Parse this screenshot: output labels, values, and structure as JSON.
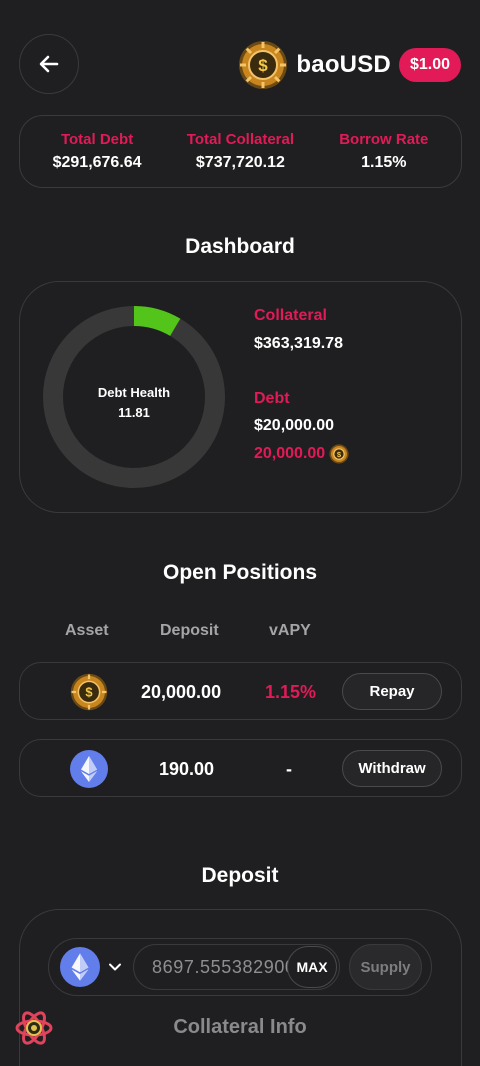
{
  "header": {
    "brand_name": "baoUSD",
    "price": "$1.00",
    "brand_icon": "baousd-coin-icon",
    "back_icon": "arrow-left-icon"
  },
  "stats": [
    {
      "label": "Total Debt",
      "value": "$291,676.64"
    },
    {
      "label": "Total Collateral",
      "value": "$737,720.12"
    },
    {
      "label": "Borrow Rate",
      "value": "1.15%"
    }
  ],
  "dashboard": {
    "title": "Dashboard",
    "health_label": "Debt Health",
    "health_value": "11.81",
    "health_gauge_fraction": 0.085,
    "collateral_label": "Collateral",
    "collateral_value": "$363,319.78",
    "debt_label": "Debt",
    "debt_usd": "$20,000.00",
    "debt_amount": "20,000.00"
  },
  "positions": {
    "title": "Open Positions",
    "columns": [
      "Asset",
      "Deposit",
      "vAPY"
    ],
    "rows": [
      {
        "asset_icon": "baousd-coin-icon",
        "deposit": "20,000.00",
        "vapy": "1.15%",
        "action": "Repay"
      },
      {
        "asset_icon": "eth-icon",
        "deposit": "190.00",
        "vapy": "-",
        "action": "Withdraw"
      }
    ]
  },
  "deposit": {
    "title": "Deposit",
    "asset_icon": "eth-icon",
    "amount_value": "8697.5553829000",
    "max_label": "MAX",
    "supply_label": "Supply"
  },
  "collateral_info": {
    "title": "Collateral Info"
  },
  "colors": {
    "accent": "#e21a57",
    "background": "#1f1f21",
    "gauge_green": "#52c41a",
    "gauge_track": "#383839",
    "eth_blue": "#627eea"
  }
}
